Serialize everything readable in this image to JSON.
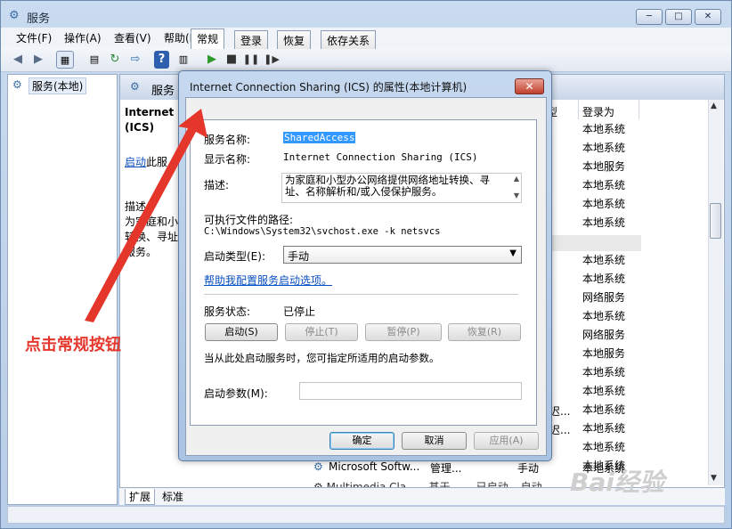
{
  "window": {
    "title": "服务",
    "min": "─",
    "max": "□",
    "close": "✕"
  },
  "menu": [
    "文件(F)",
    "操作(A)",
    "查看(V)",
    "帮助(H)"
  ],
  "left": {
    "tree_root": "服务(本地)"
  },
  "right": {
    "header_title": "服务",
    "service_name_line1": "Internet C",
    "service_name_line2": "(ICS)",
    "start_link": "启动",
    "start_link_suffix": "此服",
    "desc_label": "描述:",
    "desc_line1": "为家庭和小",
    "desc_line2": "转换、寻址",
    "desc_line3": "服务。",
    "columns": {
      "type": "型",
      "logon": "登录为"
    },
    "logon_values": [
      "本地系统",
      "本地系统",
      "本地服务",
      "本地系统",
      "本地系统",
      "本地系统",
      "本地系统",
      "本地系统",
      "本地系统",
      "网络服务",
      "本地系统",
      "网络服务",
      "本地服务",
      "本地系统",
      "本地系统",
      "本地系统",
      "本地系统",
      "本地系统",
      "本地系统"
    ],
    "partial_rows": {
      "r17": "迟...",
      "r18": "迟..."
    },
    "bottom_row": {
      "name": "Microsoft Softw...",
      "status": "管理...",
      "type": "手动",
      "logon": "本地系统"
    },
    "bottom_row2": {
      "name": "Multimedia Cla...",
      "status": "基于...",
      "type": "已启动",
      "type2": "自动"
    },
    "tabs": [
      "扩展",
      "标准"
    ]
  },
  "dialog": {
    "title": "Internet Connection Sharing (ICS) 的属性(本地计算机)",
    "close": "✕",
    "tabs": [
      "常规",
      "登录",
      "恢复",
      "依存关系"
    ],
    "service_name_label": "服务名称:",
    "service_name_value": "SharedAccess",
    "display_name_label": "显示名称:",
    "display_name_value": "Internet Connection Sharing (ICS)",
    "description_label": "描述:",
    "description_line1": "为家庭和小型办公网络提供网络地址转换、寻",
    "description_line2": "址、名称解析和/或入侵保护服务。",
    "exe_path_label": "可执行文件的路径:",
    "exe_path_value": "C:\\Windows\\System32\\svchost.exe -k netsvcs",
    "startup_type_label": "启动类型(E):",
    "startup_type_value": "手动",
    "help_link": "帮助我配置服务启动选项。",
    "status_label": "服务状态:",
    "status_value": "已停止",
    "start_btn": "启动(S)",
    "stop_btn": "停止(T)",
    "pause_btn": "暂停(P)",
    "resume_btn": "恢复(R)",
    "hint": "当从此处启动服务时，您可指定所适用的启动参数。",
    "params_label": "启动参数(M):",
    "params_value": "",
    "ok_btn": "确定",
    "cancel_btn": "取消",
    "apply_btn": "应用(A)"
  },
  "annotation": "点击常规按钮",
  "watermark": "Bai经验",
  "colors": {
    "accent_red": "#e4362b",
    "link": "#0a4fbf",
    "selection": "#3399ff"
  }
}
